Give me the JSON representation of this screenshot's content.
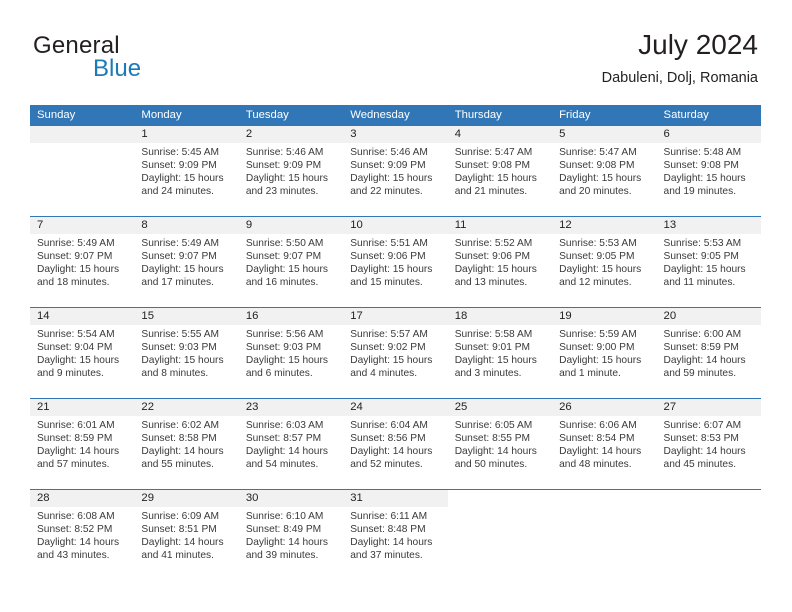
{
  "logo": {
    "word_one": "General",
    "word_two": "Blue",
    "triangle_icon": "triangle-icon",
    "brand_blue": "#1b7ab8"
  },
  "header": {
    "title": "July 2024",
    "subtitle": "Dabuleni, Dolj, Romania"
  },
  "theme": {
    "header_blue": "#3176b7",
    "daynum_band": "#f1f1f1",
    "text": "#231f20"
  },
  "calendar": {
    "weekday_headers": [
      "Sunday",
      "Monday",
      "Tuesday",
      "Wednesday",
      "Thursday",
      "Friday",
      "Saturday"
    ],
    "weeks": [
      [
        {
          "day": "",
          "lines": []
        },
        {
          "day": "1",
          "lines": [
            "Sunrise: 5:45 AM",
            "Sunset: 9:09 PM",
            "Daylight: 15 hours",
            "and 24 minutes."
          ]
        },
        {
          "day": "2",
          "lines": [
            "Sunrise: 5:46 AM",
            "Sunset: 9:09 PM",
            "Daylight: 15 hours",
            "and 23 minutes."
          ]
        },
        {
          "day": "3",
          "lines": [
            "Sunrise: 5:46 AM",
            "Sunset: 9:09 PM",
            "Daylight: 15 hours",
            "and 22 minutes."
          ]
        },
        {
          "day": "4",
          "lines": [
            "Sunrise: 5:47 AM",
            "Sunset: 9:08 PM",
            "Daylight: 15 hours",
            "and 21 minutes."
          ]
        },
        {
          "day": "5",
          "lines": [
            "Sunrise: 5:47 AM",
            "Sunset: 9:08 PM",
            "Daylight: 15 hours",
            "and 20 minutes."
          ]
        },
        {
          "day": "6",
          "lines": [
            "Sunrise: 5:48 AM",
            "Sunset: 9:08 PM",
            "Daylight: 15 hours",
            "and 19 minutes."
          ]
        }
      ],
      [
        {
          "day": "7",
          "lines": [
            "Sunrise: 5:49 AM",
            "Sunset: 9:07 PM",
            "Daylight: 15 hours",
            "and 18 minutes."
          ]
        },
        {
          "day": "8",
          "lines": [
            "Sunrise: 5:49 AM",
            "Sunset: 9:07 PM",
            "Daylight: 15 hours",
            "and 17 minutes."
          ]
        },
        {
          "day": "9",
          "lines": [
            "Sunrise: 5:50 AM",
            "Sunset: 9:07 PM",
            "Daylight: 15 hours",
            "and 16 minutes."
          ]
        },
        {
          "day": "10",
          "lines": [
            "Sunrise: 5:51 AM",
            "Sunset: 9:06 PM",
            "Daylight: 15 hours",
            "and 15 minutes."
          ]
        },
        {
          "day": "11",
          "lines": [
            "Sunrise: 5:52 AM",
            "Sunset: 9:06 PM",
            "Daylight: 15 hours",
            "and 13 minutes."
          ]
        },
        {
          "day": "12",
          "lines": [
            "Sunrise: 5:53 AM",
            "Sunset: 9:05 PM",
            "Daylight: 15 hours",
            "and 12 minutes."
          ]
        },
        {
          "day": "13",
          "lines": [
            "Sunrise: 5:53 AM",
            "Sunset: 9:05 PM",
            "Daylight: 15 hours",
            "and 11 minutes."
          ]
        }
      ],
      [
        {
          "day": "14",
          "lines": [
            "Sunrise: 5:54 AM",
            "Sunset: 9:04 PM",
            "Daylight: 15 hours",
            "and 9 minutes."
          ]
        },
        {
          "day": "15",
          "lines": [
            "Sunrise: 5:55 AM",
            "Sunset: 9:03 PM",
            "Daylight: 15 hours",
            "and 8 minutes."
          ]
        },
        {
          "day": "16",
          "lines": [
            "Sunrise: 5:56 AM",
            "Sunset: 9:03 PM",
            "Daylight: 15 hours",
            "and 6 minutes."
          ]
        },
        {
          "day": "17",
          "lines": [
            "Sunrise: 5:57 AM",
            "Sunset: 9:02 PM",
            "Daylight: 15 hours",
            "and 4 minutes."
          ]
        },
        {
          "day": "18",
          "lines": [
            "Sunrise: 5:58 AM",
            "Sunset: 9:01 PM",
            "Daylight: 15 hours",
            "and 3 minutes."
          ]
        },
        {
          "day": "19",
          "lines": [
            "Sunrise: 5:59 AM",
            "Sunset: 9:00 PM",
            "Daylight: 15 hours",
            "and 1 minute."
          ]
        },
        {
          "day": "20",
          "lines": [
            "Sunrise: 6:00 AM",
            "Sunset: 8:59 PM",
            "Daylight: 14 hours",
            "and 59 minutes."
          ]
        }
      ],
      [
        {
          "day": "21",
          "lines": [
            "Sunrise: 6:01 AM",
            "Sunset: 8:59 PM",
            "Daylight: 14 hours",
            "and 57 minutes."
          ]
        },
        {
          "day": "22",
          "lines": [
            "Sunrise: 6:02 AM",
            "Sunset: 8:58 PM",
            "Daylight: 14 hours",
            "and 55 minutes."
          ]
        },
        {
          "day": "23",
          "lines": [
            "Sunrise: 6:03 AM",
            "Sunset: 8:57 PM",
            "Daylight: 14 hours",
            "and 54 minutes."
          ]
        },
        {
          "day": "24",
          "lines": [
            "Sunrise: 6:04 AM",
            "Sunset: 8:56 PM",
            "Daylight: 14 hours",
            "and 52 minutes."
          ]
        },
        {
          "day": "25",
          "lines": [
            "Sunrise: 6:05 AM",
            "Sunset: 8:55 PM",
            "Daylight: 14 hours",
            "and 50 minutes."
          ]
        },
        {
          "day": "26",
          "lines": [
            "Sunrise: 6:06 AM",
            "Sunset: 8:54 PM",
            "Daylight: 14 hours",
            "and 48 minutes."
          ]
        },
        {
          "day": "27",
          "lines": [
            "Sunrise: 6:07 AM",
            "Sunset: 8:53 PM",
            "Daylight: 14 hours",
            "and 45 minutes."
          ]
        }
      ],
      [
        {
          "day": "28",
          "lines": [
            "Sunrise: 6:08 AM",
            "Sunset: 8:52 PM",
            "Daylight: 14 hours",
            "and 43 minutes."
          ]
        },
        {
          "day": "29",
          "lines": [
            "Sunrise: 6:09 AM",
            "Sunset: 8:51 PM",
            "Daylight: 14 hours",
            "and 41 minutes."
          ]
        },
        {
          "day": "30",
          "lines": [
            "Sunrise: 6:10 AM",
            "Sunset: 8:49 PM",
            "Daylight: 14 hours",
            "and 39 minutes."
          ]
        },
        {
          "day": "31",
          "lines": [
            "Sunrise: 6:11 AM",
            "Sunset: 8:48 PM",
            "Daylight: 14 hours",
            "and 37 minutes."
          ]
        },
        {
          "day": "",
          "lines": []
        },
        {
          "day": "",
          "lines": []
        },
        {
          "day": "",
          "lines": []
        }
      ]
    ]
  }
}
